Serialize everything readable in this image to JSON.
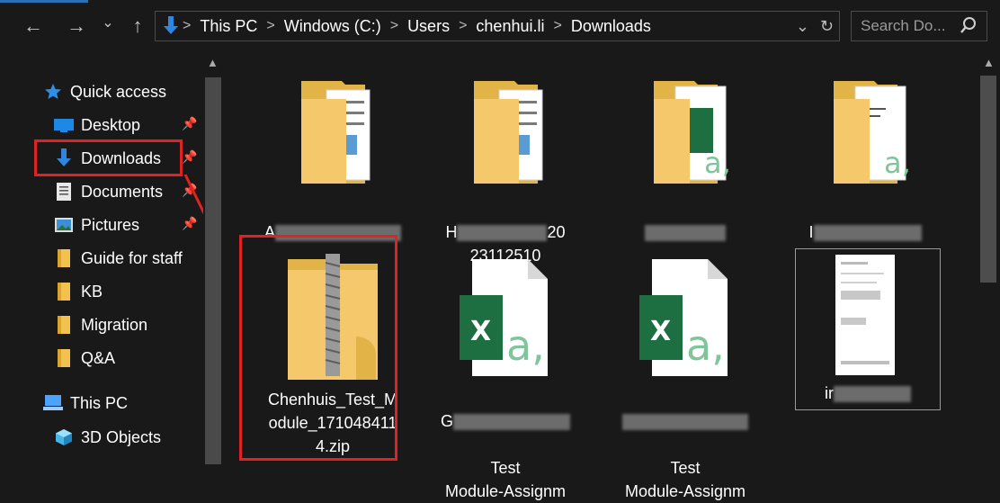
{
  "nav": {
    "back_glyph": "←",
    "forward_glyph": "→",
    "recent_glyph": "⌄",
    "up_glyph": "↑"
  },
  "breadcrumb": [
    "This PC",
    "Windows (C:)",
    "Users",
    "chenhui.li",
    "Downloads"
  ],
  "breadcrumb_separator": ">",
  "address_dropdown_glyph": "⌄",
  "refresh_glyph": "↻",
  "search": {
    "placeholder": "Search Do..."
  },
  "sidebar": {
    "quick_access": "Quick access",
    "items": [
      {
        "label": "Desktop",
        "icon": "desktop-icon",
        "pinned": true
      },
      {
        "label": "Downloads",
        "icon": "downloads-icon",
        "pinned": true
      },
      {
        "label": "Documents",
        "icon": "documents-icon",
        "pinned": true
      },
      {
        "label": "Pictures",
        "icon": "pictures-icon",
        "pinned": true
      },
      {
        "label": "Guide for staff",
        "icon": "folder-icon",
        "pinned": false
      },
      {
        "label": "KB",
        "icon": "folder-icon",
        "pinned": false
      },
      {
        "label": "Migration",
        "icon": "folder-icon",
        "pinned": false
      },
      {
        "label": "Q&A",
        "icon": "folder-icon",
        "pinned": false
      }
    ],
    "this_pc": "This PC",
    "objects_3d": "3D Objects"
  },
  "files": [
    {
      "name": "A",
      "type": "folder",
      "blurred": true
    },
    {
      "name": "H",
      "name_tail": "20\n23112510",
      "type": "folder",
      "blurred": true
    },
    {
      "name": "",
      "type": "folder-excel",
      "blurred": true
    },
    {
      "name": "I",
      "type": "folder-doc",
      "blurred": true
    },
    {
      "name": "Chenhuis_Test_M\nodule_171048411\n4.zip",
      "type": "zip",
      "highlighted": true
    },
    {
      "name": "G",
      "name_tail": "Test\nModule-Assignm",
      "type": "excel",
      "blurred": true
    },
    {
      "name": "",
      "name_tail": "Test\nModule-Assignm",
      "type": "excel",
      "blurred": true
    },
    {
      "name": "ir",
      "type": "image",
      "blurred": true,
      "selected": true
    }
  ],
  "colors": {
    "background": "#191919",
    "highlight": "#e02222",
    "folder": "#f5c96b",
    "excel": "#1d6f42",
    "accent": "#2b6fb6"
  }
}
